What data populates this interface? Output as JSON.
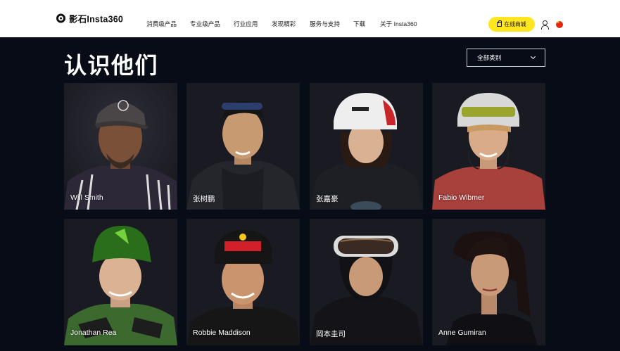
{
  "header": {
    "brand": "影石Insta360",
    "nav": [
      "消费级产品",
      "专业级产品",
      "行业应用",
      "发现精彩",
      "服务与支持",
      "下载",
      "关于 Insta360"
    ],
    "shop_label": "在线商城"
  },
  "page": {
    "title": "认识他们",
    "filter_label": "全部类别"
  },
  "people": [
    "Will Smith",
    "张树鹏",
    "张嘉豪",
    "Fabio Wibmer",
    "Jonathan Rea",
    "Robbie Maddison",
    "岡本圭司",
    "Anne Gumiran"
  ],
  "colors": {
    "background": "#070c17",
    "header": "#ffffff",
    "shop_button": "#ffe61e",
    "card": "#1b1c24"
  },
  "icons": [
    "logo-icon",
    "bag-icon",
    "user-icon",
    "flag-icon",
    "chevron-down-icon"
  ]
}
